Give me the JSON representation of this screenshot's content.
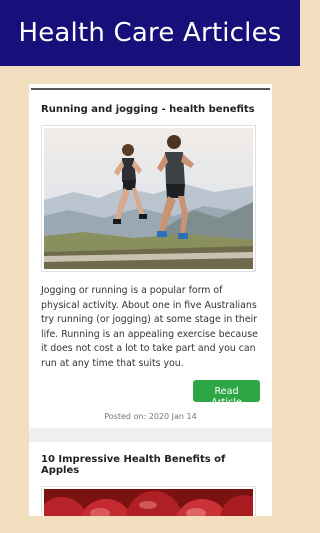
{
  "header": {
    "title": "Health Care Articles"
  },
  "articles": [
    {
      "title": "Running and jogging - health benefits",
      "image_icon": "running-couple-photo",
      "excerpt": "Jogging or running is a popular form of physical activity. About one in five Australians try running (or jogging) at some stage in their life. Running is an appealing exercise because it does not cost a lot to take part and you can run at any time that suits you.",
      "button_label": "Read Article",
      "posted": "Posted on: 2020 Jan 14"
    },
    {
      "title": "10 Impressive Health Benefits of Apples",
      "image_icon": "apples-photo"
    }
  ],
  "colors": {
    "header_bg": "#17107a",
    "page_bg": "#f3dfbf",
    "button_bg": "#2ea645"
  }
}
